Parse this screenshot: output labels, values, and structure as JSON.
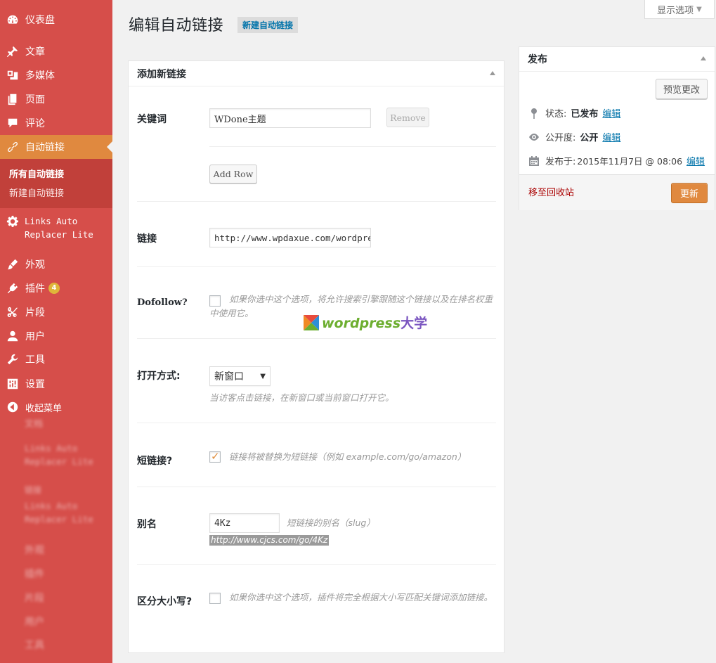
{
  "sidebar": {
    "items": [
      {
        "label": "仪表盘",
        "icon": "dashboard-icon"
      },
      {
        "label": "文章",
        "icon": "pin-icon"
      },
      {
        "label": "多媒体",
        "icon": "media-icon"
      },
      {
        "label": "页面",
        "icon": "page-icon"
      },
      {
        "label": "评论",
        "icon": "comment-icon"
      },
      {
        "label": "自动链接",
        "icon": "link-icon"
      },
      {
        "label": "外观",
        "icon": "brush-icon"
      },
      {
        "label": "插件",
        "icon": "plugin-icon",
        "badge": "4"
      },
      {
        "label": "片段",
        "icon": "scissors-icon"
      },
      {
        "label": "用户",
        "icon": "user-icon"
      },
      {
        "label": "工具",
        "icon": "wrench-icon"
      },
      {
        "label": "设置",
        "icon": "settings-icon"
      },
      {
        "label": "收起菜单",
        "icon": "collapse-icon"
      }
    ],
    "submenu": [
      {
        "label": "所有自动链接"
      },
      {
        "label": "新建自动链接"
      }
    ],
    "links_auto": "Links Auto\nReplacer Lite",
    "ghost": {
      "a": "文档",
      "b": "Links Auto\nReplacer Lite",
      "c": "链接",
      "d": "外观",
      "e": "插件",
      "f": "片段",
      "g": "用户",
      "h": "工具"
    }
  },
  "header": {
    "title": "编辑自动链接",
    "add_new": "新建自动链接",
    "screen_options": "显示选项"
  },
  "form": {
    "box_title": "添加新链接",
    "keyword_label": "关键词",
    "keyword_value": "WDone主题",
    "remove_label": "Remove",
    "add_row_label": "Add Row",
    "link_label": "链接",
    "link_value": "http://www.wpdaxue.com/wordpres",
    "dofollow_label": "Dofollow?",
    "dofollow_desc": "如果你选中这个选项，将允许搜索引擎跟随这个链接以及在排名权重中使用它。",
    "open_label": "打开方式:",
    "open_value": "新窗口",
    "open_desc": "当访客点击链接，在新窗口或当前窗口打开它。",
    "short_label": "短链接?",
    "short_desc": "链接将被替换为短链接（例如 example.com/go/amazon）",
    "alias_label": "别名",
    "alias_value": "4Kz",
    "alias_desc": "短链接的别名（slug）",
    "alias_url": "http://www.cjcs.com/go/4Kz",
    "case_label": "区分大小写?",
    "case_desc": "如果你选中这个选项，插件将完全根据大小写匹配关键词添加链接。"
  },
  "watermark": {
    "text": "wordpress",
    "cn": "大学"
  },
  "publish": {
    "title": "发布",
    "preview_label": "预览更改",
    "status_label": "状态:",
    "status_value": "已发布",
    "visibility_label": "公开度:",
    "visibility_value": "公开",
    "published_label": "发布于:",
    "published_value": "2015年11月7日 @ 08:06",
    "edit_label": "编辑",
    "trash_label": "移至回收站",
    "update_label": "更新"
  },
  "colors": {
    "sidebar_bg": "#d64e4a",
    "active_bg": "#e0893f",
    "link": "#0073aa"
  }
}
